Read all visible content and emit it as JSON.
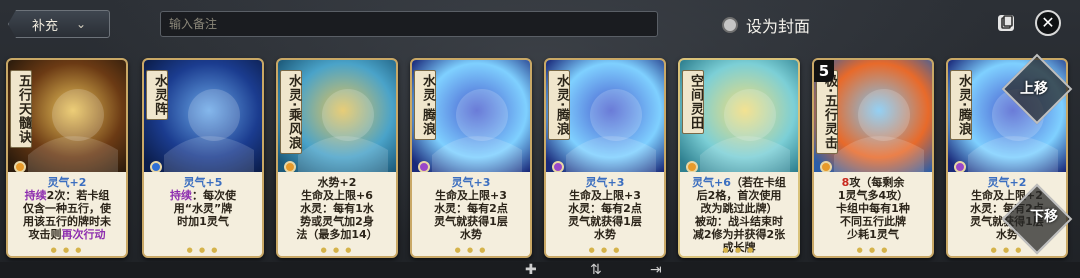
{
  "header": {
    "category_label": "补充",
    "note_placeholder": "输入备注",
    "cover_label": "设为封面"
  },
  "cards": [
    {
      "name": "五行天髓诀",
      "gem": "#e79a2a",
      "lines": [
        {
          "parts": [
            {
              "t": "灵气+2",
              "c": "blue"
            }
          ]
        },
        {
          "parts": [
            {
              "t": "持续",
              "c": "purple"
            },
            {
              "t": "2次：若卡组",
              "c": ""
            }
          ]
        },
        {
          "parts": [
            {
              "t": "仅含一种五行，使",
              "c": ""
            }
          ]
        },
        {
          "parts": [
            {
              "t": "用该五行的牌时未",
              "c": ""
            }
          ]
        },
        {
          "parts": [
            {
              "t": "攻击则",
              "c": ""
            },
            {
              "t": "再次行动",
              "c": "purple"
            }
          ]
        }
      ]
    },
    {
      "name": "水灵阵",
      "gem": "#2f6fd6",
      "lines": [
        {
          "parts": [
            {
              "t": "灵气+5",
              "c": "blue"
            }
          ]
        },
        {
          "parts": [
            {
              "t": "持续",
              "c": "purple"
            },
            {
              "t": "：每次使",
              "c": ""
            }
          ]
        },
        {
          "parts": [
            {
              "t": "用“水灵”牌",
              "c": ""
            }
          ]
        },
        {
          "parts": [
            {
              "t": "时加1灵气",
              "c": ""
            }
          ]
        }
      ]
    },
    {
      "name": "水灵·乘风浪",
      "gem": "#e79a2a",
      "lines": [
        {
          "parts": [
            {
              "t": "水势+2",
              "c": ""
            }
          ]
        },
        {
          "parts": [
            {
              "t": "生命及上限+6",
              "c": ""
            }
          ]
        },
        {
          "parts": [
            {
              "t": "水灵：每有1水",
              "c": ""
            }
          ]
        },
        {
          "parts": [
            {
              "t": "势或灵气加2身",
              "c": ""
            }
          ]
        },
        {
          "parts": [
            {
              "t": "法（最多加14）",
              "c": ""
            }
          ]
        }
      ]
    },
    {
      "name": "水灵·腾浪",
      "gem": "#9a48c9",
      "lines": [
        {
          "parts": [
            {
              "t": "灵气+3",
              "c": "blue"
            }
          ]
        },
        {
          "parts": [
            {
              "t": "生命及上限+3",
              "c": ""
            }
          ]
        },
        {
          "parts": [
            {
              "t": "水灵：每有2点",
              "c": ""
            }
          ]
        },
        {
          "parts": [
            {
              "t": "灵气就获得1层",
              "c": ""
            }
          ]
        },
        {
          "parts": [
            {
              "t": "水势",
              "c": ""
            }
          ]
        }
      ]
    },
    {
      "name": "水灵·腾浪",
      "gem": "#9a48c9",
      "lines": [
        {
          "parts": [
            {
              "t": "灵气+3",
              "c": "blue"
            }
          ]
        },
        {
          "parts": [
            {
              "t": "生命及上限+3",
              "c": ""
            }
          ]
        },
        {
          "parts": [
            {
              "t": "水灵：每有2点",
              "c": ""
            }
          ]
        },
        {
          "parts": [
            {
              "t": "灵气就获得1层",
              "c": ""
            }
          ]
        },
        {
          "parts": [
            {
              "t": "水势",
              "c": ""
            }
          ]
        }
      ]
    },
    {
      "name": "空间灵田",
      "gem": "#e79a2a",
      "lines": [
        {
          "parts": [
            {
              "t": "灵气+6",
              "c": "blue"
            },
            {
              "t": "（若在卡组",
              "c": ""
            }
          ]
        },
        {
          "parts": [
            {
              "t": "后2格，首次使用",
              "c": ""
            }
          ]
        },
        {
          "parts": [
            {
              "t": "改为跳过此牌）",
              "c": ""
            }
          ]
        },
        {
          "parts": [
            {
              "t": "被动：战斗结束时",
              "c": ""
            }
          ]
        },
        {
          "parts": [
            {
              "t": "减2修为并获得2张",
              "c": ""
            }
          ]
        },
        {
          "parts": [
            {
              "t": "成长牌",
              "c": ""
            }
          ]
        }
      ]
    },
    {
      "name": "极·五行灵击",
      "level": "5",
      "gem": "#e79a2a",
      "lines": [
        {
          "parts": [
            {
              "t": "8",
              "c": "red"
            },
            {
              "t": "攻（每剩余",
              "c": ""
            }
          ]
        },
        {
          "parts": [
            {
              "t": "1灵气多4攻）",
              "c": ""
            }
          ]
        },
        {
          "parts": [
            {
              "t": "卡组中每有1种",
              "c": ""
            }
          ]
        },
        {
          "parts": [
            {
              "t": "不同五行此牌",
              "c": ""
            }
          ]
        },
        {
          "parts": [
            {
              "t": "少耗1灵气",
              "c": ""
            }
          ]
        }
      ]
    },
    {
      "name": "水灵·腾浪",
      "gem": "#9a48c9",
      "lines": [
        {
          "parts": [
            {
              "t": "灵气+2",
              "c": "blue"
            }
          ]
        },
        {
          "parts": [
            {
              "t": "生命及上限+2",
              "c": ""
            }
          ]
        },
        {
          "parts": [
            {
              "t": "水灵：每有2点",
              "c": ""
            }
          ]
        },
        {
          "parts": [
            {
              "t": "灵气就获得1层",
              "c": ""
            }
          ]
        },
        {
          "parts": [
            {
              "t": "水势",
              "c": ""
            }
          ]
        }
      ]
    }
  ],
  "move_up_label": "上移",
  "move_down_label": "下移"
}
